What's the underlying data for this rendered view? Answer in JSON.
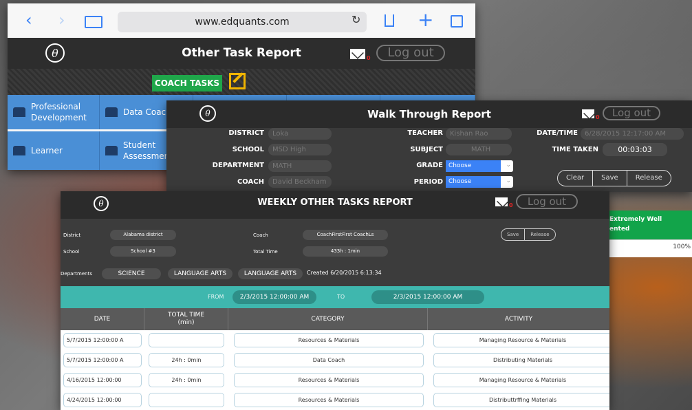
{
  "other_task": {
    "browser": {
      "url": "www.edquants.com",
      "nav_back": "‹",
      "nav_forward": "›",
      "reload": "↻",
      "add": "+"
    },
    "logo": "θ",
    "title": "Other Task Report",
    "mail_count": "0",
    "logout": "Log out",
    "coach_tasks": "COACH TASKS",
    "tiles_row1": [
      "Professional Development",
      "Data Coach"
    ],
    "tiles_row2": [
      "Learner",
      "Student Assessment"
    ]
  },
  "walk_through": {
    "logo": "θ",
    "title": "Walk Through Report",
    "mail_count": "0",
    "logout": "Log out",
    "labels": {
      "district": "DISTRICT",
      "school": "SCHOOL",
      "department": "DEPARTMENT",
      "coach": "COACH",
      "teacher": "TEACHER",
      "subject": "SUBJECT",
      "grade": "GRADE",
      "period": "PERIOD",
      "datetime": "DATE/TIME",
      "time_taken": "TIME TAKEN"
    },
    "values": {
      "district": "Loka",
      "school": "MSD High",
      "department": "MATH",
      "coach": "David Beckham",
      "teacher": "Kishan Rao",
      "subject": "MATH",
      "grade": "Choose",
      "period": "Choose",
      "datetime": "6/28/2015 12:17:00 AM",
      "time_taken": "00:03:03"
    },
    "actions": [
      "Clear",
      "Save",
      "Release"
    ]
  },
  "weekly": {
    "logo": "θ",
    "title": "WEEKLY OTHER TASKS REPORT",
    "mail_count": "0",
    "logout": "Log out",
    "labels": {
      "district": "District",
      "school": "School",
      "coach": "Coach",
      "total_time": "Total Time",
      "departments": "Departments"
    },
    "values": {
      "district": "Alabama district",
      "school": "School #3",
      "coach": "CoachFirstFirst CoachLs",
      "total_time": "433h : 1min"
    },
    "actions": [
      "Save",
      "Release"
    ],
    "departments": [
      "SCIENCE",
      "LANGUAGE ARTS",
      "LANGUAGE ARTS"
    ],
    "created": "Created 6/20/2015 6:13:34",
    "from_label": "FROM",
    "to_label": "TO",
    "from_date": "2/3/2015 12:00:00 AM",
    "to_date": "2/3/2015 12:00:00 AM",
    "columns": {
      "date": "DATE",
      "total_time": "TOTAL TIME",
      "total_time_unit": "(min)",
      "category": "CATEGORY",
      "activity": "ACTIVITY"
    },
    "rows": [
      {
        "date": "5/7/2015 12:00:00 A",
        "total_time": "",
        "category": "Resources & Materials",
        "activity": "Managing Resource & Materials"
      },
      {
        "date": "5/7/2015 12:00:00 A",
        "total_time": "24h : 0min",
        "category": "Data Coach",
        "activity": "Distributing Materials"
      },
      {
        "date": "4/16/2015 12:00:00",
        "total_time": "24h : 0min",
        "category": "Resources & Materials",
        "activity": "Managing Resource & Materials"
      },
      {
        "date": "4/24/2015 12:00:00",
        "total_time": "",
        "category": "Resources & Materials",
        "activity": "Distributtrffing Materials"
      }
    ]
  },
  "overlay": {
    "status_line1": "Extremely Well",
    "status_line2": "ented",
    "percent": "100%",
    "status_color": "#12a44a"
  }
}
